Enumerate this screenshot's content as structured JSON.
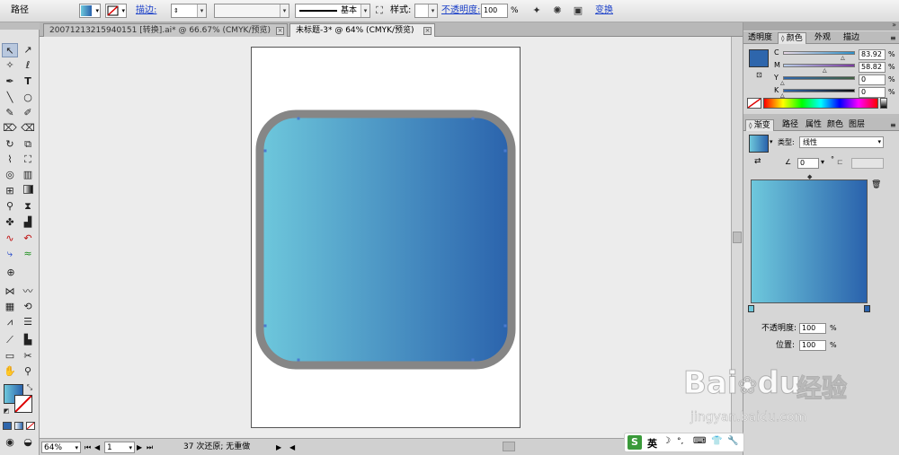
{
  "control_bar": {
    "object_type": "路径",
    "stroke_label": "描边:",
    "stroke_profile": "基本",
    "style_label": "样式:",
    "opacity_label": "不透明度:",
    "opacity_value": "100",
    "percent": "%",
    "transform_label": "变换"
  },
  "tabs": [
    {
      "label": "20071213215940151 [转换].ai* @ 66.67% (CMYK/预览)",
      "active": false
    },
    {
      "label": "未标题-3* @ 64% (CMYK/预览)",
      "active": true
    }
  ],
  "status": {
    "zoom": "64%",
    "page": "1",
    "undo_text": "37 次还原; 无重做"
  },
  "panel_top": {
    "tabs": [
      "透明度",
      "颜色",
      "外观",
      "描边"
    ],
    "active_tab": "颜色",
    "channels": [
      {
        "label": "C",
        "value": "83.92"
      },
      {
        "label": "M",
        "value": "58.82"
      },
      {
        "label": "Y",
        "value": "0"
      },
      {
        "label": "K",
        "value": "0"
      }
    ]
  },
  "panel_gradient": {
    "tabs": [
      "渐变",
      "路径",
      "属性",
      "颜色",
      "图层"
    ],
    "active_tab": "渐变",
    "type_label": "类型:",
    "type_value": "线性",
    "angle_value": "0",
    "degree": "°",
    "opacity_label": "不透明度:",
    "opacity_value": "100",
    "position_label": "位置:",
    "position_value": "100",
    "percent": "%"
  },
  "ime": {
    "label": "英"
  },
  "watermark": {
    "brand": "Bai",
    "brand2": "du",
    "cn": "经验",
    "url": "jingyan.baidu.com"
  },
  "colors": {
    "gradient_start": "#6ec8dc",
    "gradient_end": "#2a62ac",
    "frame_gray": "#868686",
    "fill_swatch": "#2e66ac",
    "link_blue": "#1a3fc8"
  }
}
